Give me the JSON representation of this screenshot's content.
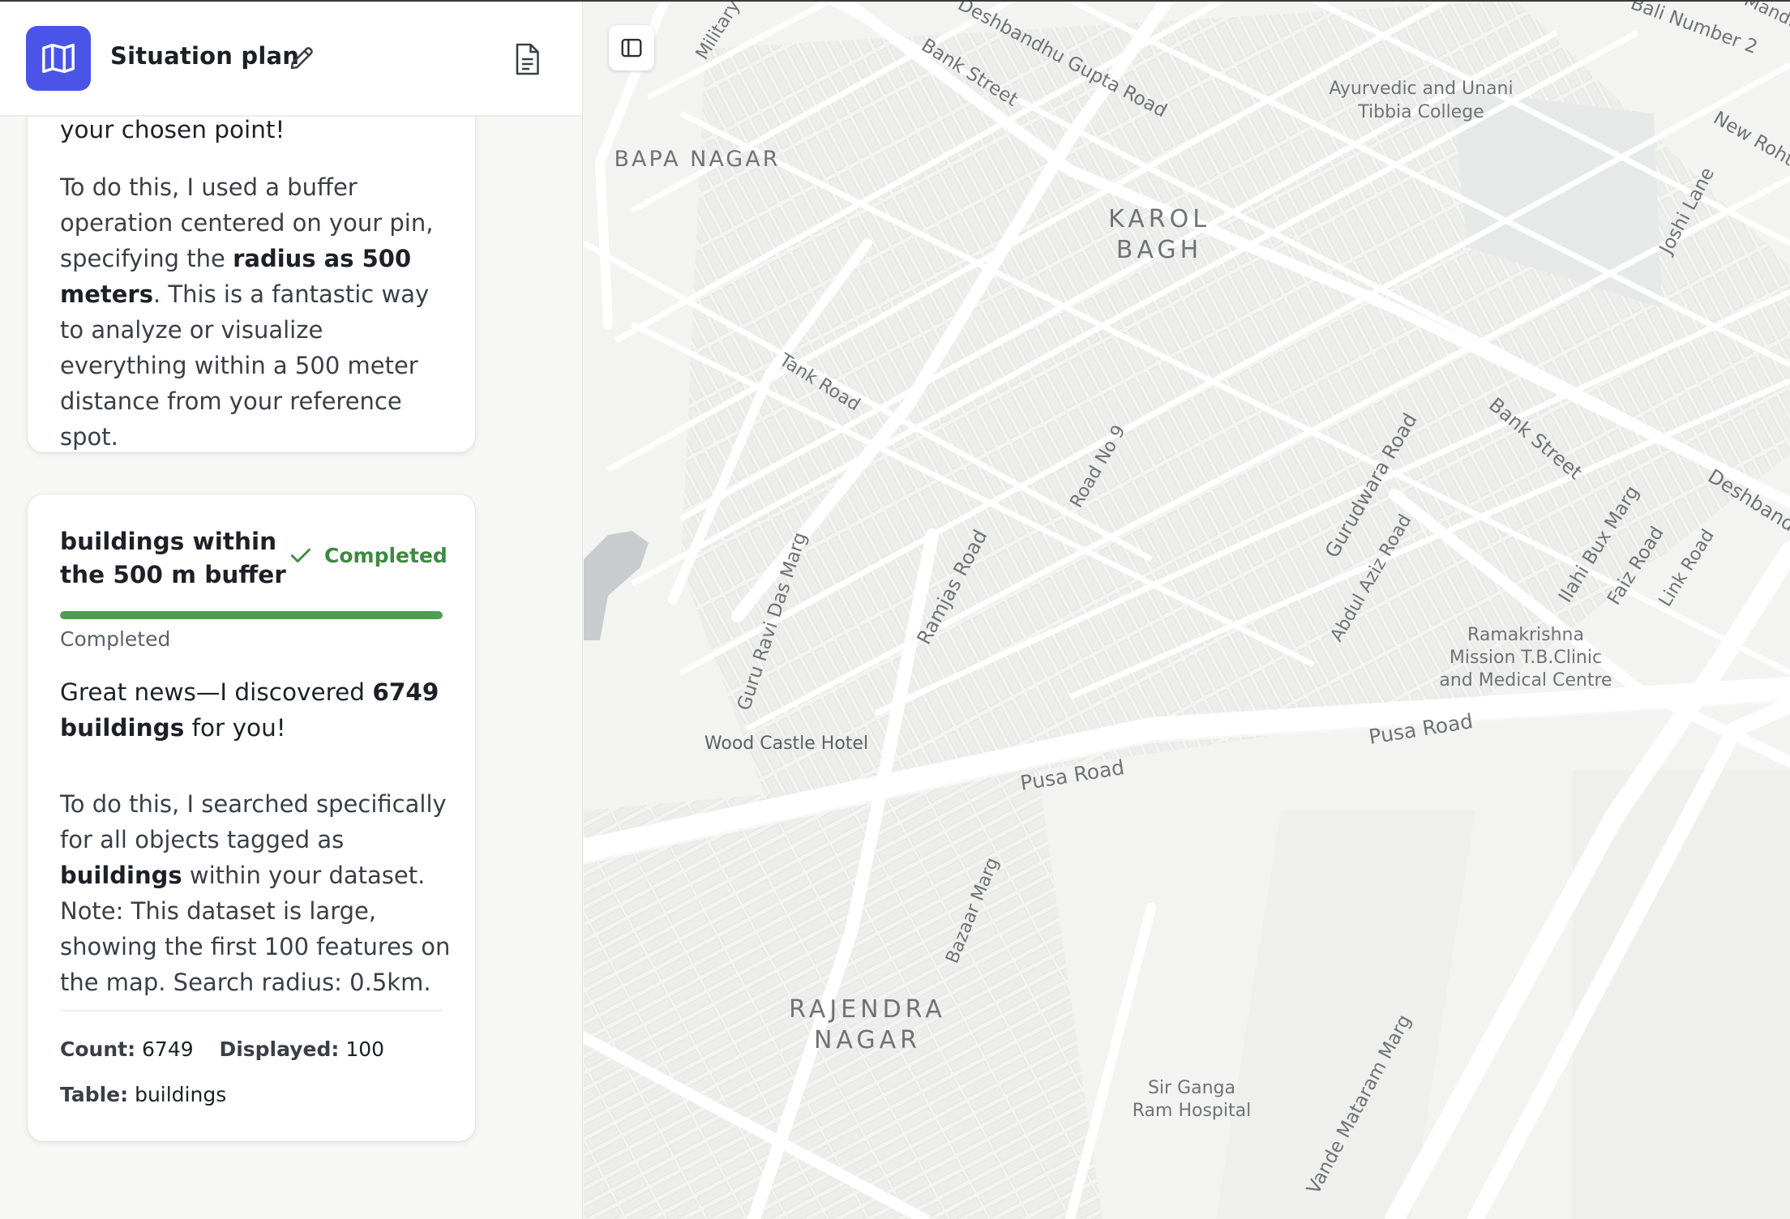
{
  "header": {
    "title": "Situation plan"
  },
  "icons": {
    "logo": "map-icon",
    "edit": "pencil-icon",
    "report": "document-icon",
    "sidebar_toggle": "sidebar-toggle-icon",
    "check": "check-icon"
  },
  "colors": {
    "brand": "#4a55e8",
    "success": "#3d8a40",
    "progress": "#4d9e52"
  },
  "card_buffer": {
    "tail": "your chosen point!",
    "para_1": "To do this, I used a buffer operation centered on your pin, specifying the ",
    "para_bold_1": "radius as 500 meters",
    "para_2": ". This is a fantastic way to analyze or visualize everything within a 500 meter distance from your reference spot."
  },
  "card_buildings": {
    "title": "buildings within the 500 m buffer",
    "status": "Completed",
    "progress": 1.0,
    "progress_label": "Completed",
    "lead_1": "Great news—I discovered ",
    "lead_bold_1": "6749 buildings",
    "lead_2": " for you!",
    "para_1": "To do this, I searched specifically for all objects tagged as ",
    "para_bold_1": "buildings",
    "para_2": " within your dataset. Note: This dataset is large, showing the first 100 features on the map. Search radius: 0.5km.",
    "count_label": "Count:",
    "count_value": "6749",
    "displayed_label": "Displayed:",
    "displayed_value": "100",
    "table_label": "Table:",
    "table_value": "buildings"
  },
  "map": {
    "labels": {
      "military": "Military R",
      "deshbandhu_top": "Deshbandhu Gupta Road",
      "bank_street_top": "Bank Street",
      "ali_number": "Bali Number 2",
      "mandi": "Mandi",
      "ayurvedic_1": "Ayurvedic and Unani",
      "ayurvedic_2": "Tibbia College",
      "new_rohtak": "New Roht",
      "bapa_nagar": "BAPA NAGAR",
      "karol_1": "KAROL",
      "karol_2": "BAGH",
      "joshi_lane": "Joshi Lane",
      "tank_road": "Tank Road",
      "road_no_9": "Road No 9",
      "bank_street_2": "Bank Street",
      "deshband_2": "Deshband",
      "gurudwara": "Gurudwara Road",
      "abdul_aziz": "Abdul Aziz Road",
      "ilahi_bux": "Ilahi Bux Marg",
      "faiz_road": "Faiz Road",
      "link_road": "Link Road",
      "guru_ravi": "Guru Ravi Das Marg",
      "ramjas": "Ramjas Road",
      "ramakrishna_1": "Ramakrishna",
      "ramakrishna_2": "Mission T.B.Clinic",
      "ramakrishna_3": "and Medical Centre",
      "wood_castle": "Wood Castle Hotel",
      "pusa_road_1": "Pusa Road",
      "pusa_road_2": "Pusa Road",
      "bazaar_marg": "Bazaar Marg",
      "rajendra_1": "RAJENDRA",
      "rajendra_2": "NAGAR",
      "sir_ganga_1": "Sir Ganga",
      "sir_ganga_2": "Ram Hospital",
      "vande_mataram": "Vande Mataram Marg"
    }
  }
}
